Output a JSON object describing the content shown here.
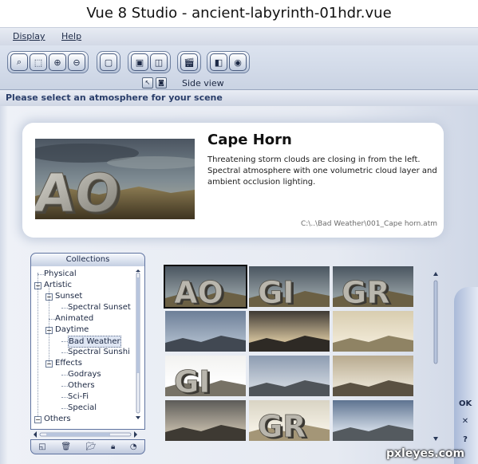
{
  "window": {
    "title": "Vue 8 Studio - ancient-labyrinth-01hdr.vue"
  },
  "menu": {
    "items": [
      "Display",
      "Help"
    ]
  },
  "toolbar": {
    "side_view_label": "Side view",
    "groups": [
      [
        "zoom-fit-icon",
        "zoom-region-icon",
        "zoom-in-icon",
        "zoom-out-icon"
      ],
      [
        "maximize-view-icon"
      ],
      [
        "frame-icon",
        "render-area-icon"
      ],
      [
        "clapboard-icon"
      ],
      [
        "camera-settings-icon",
        "render-camera-icon"
      ]
    ]
  },
  "dialog": {
    "title": "Please select an atmosphere for your scene",
    "selected": {
      "name": "Cape Horn",
      "description": "Threatening storm clouds are closing in from the left. Spectral atmosphere with one volumetric cloud layer and ambient occlusion lighting.",
      "path": "C:\\..\\Bad Weather\\001_Cape horn.atm"
    }
  },
  "collections": {
    "header": "Collections",
    "items": [
      {
        "label": "Physical",
        "level": 0,
        "toggle": ""
      },
      {
        "label": "Artistic",
        "level": 0,
        "toggle": "−"
      },
      {
        "label": "Sunset",
        "level": 1,
        "toggle": "−"
      },
      {
        "label": "Spectral Sunset",
        "level": 2,
        "toggle": ""
      },
      {
        "label": "Animated",
        "level": 1,
        "toggle": ""
      },
      {
        "label": "Daytime",
        "level": 1,
        "toggle": "−"
      },
      {
        "label": "Bad Weather",
        "level": 2,
        "toggle": "",
        "selected": true
      },
      {
        "label": "Spectral Sunshi",
        "level": 2,
        "toggle": ""
      },
      {
        "label": "Effects",
        "level": 1,
        "toggle": "−"
      },
      {
        "label": "Godrays",
        "level": 2,
        "toggle": ""
      },
      {
        "label": "Others",
        "level": 2,
        "toggle": ""
      },
      {
        "label": "Sci-Fi",
        "level": 2,
        "toggle": ""
      },
      {
        "label": "Special",
        "level": 2,
        "toggle": ""
      },
      {
        "label": "Others",
        "level": 0,
        "toggle": "−"
      }
    ],
    "tools": [
      "new-collection-icon",
      "delete-icon",
      "browse-icon",
      "lock-icon",
      "help-icon"
    ]
  },
  "thumbnails": [
    {
      "text": "AO",
      "sky": "storm",
      "selected": true
    },
    {
      "text": "GI",
      "sky": "storm"
    },
    {
      "text": "GR",
      "sky": "storm"
    },
    {
      "text": "",
      "sky": "blue-haze"
    },
    {
      "text": "",
      "sky": "golden-cloud"
    },
    {
      "text": "",
      "sky": "golden-haze"
    },
    {
      "text": "GI",
      "sky": "white"
    },
    {
      "text": "",
      "sky": "pale-blue"
    },
    {
      "text": "",
      "sky": "warm-mist"
    },
    {
      "text": "",
      "sky": "grey-dusk"
    },
    {
      "text": "GR",
      "sky": "pale-gold"
    },
    {
      "text": "",
      "sky": "blue-streak"
    }
  ],
  "side_buttons": {
    "ok": "OK",
    "cancel": "✕",
    "help": "?"
  },
  "watermark": "pxleyes.com"
}
